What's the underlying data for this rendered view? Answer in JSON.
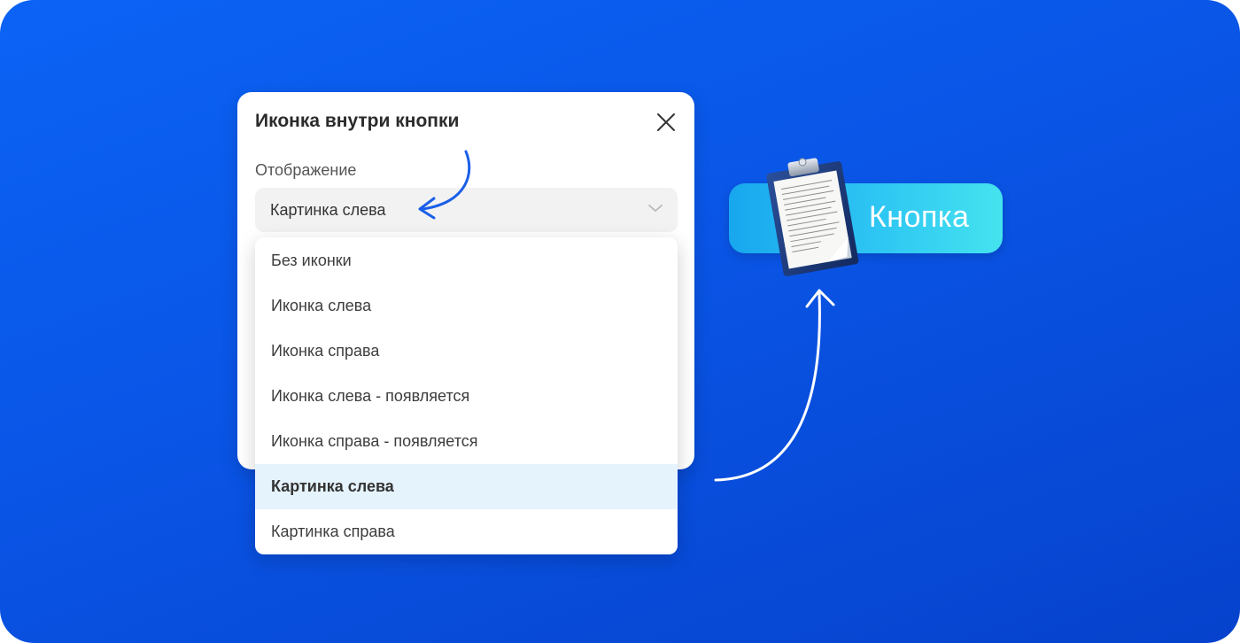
{
  "dialog": {
    "title": "Иконка внутри кнопки",
    "field_label": "Отображение",
    "select_value": "Картинка слева"
  },
  "menu": {
    "items": [
      {
        "label": "Без иконки",
        "selected": false
      },
      {
        "label": "Иконка слева",
        "selected": false
      },
      {
        "label": "Иконка справа",
        "selected": false
      },
      {
        "label": "Иконка слева - появляется",
        "selected": false
      },
      {
        "label": "Иконка справа - появляется",
        "selected": false
      },
      {
        "label": "Картинка слева",
        "selected": true
      },
      {
        "label": "Картинка справа",
        "selected": false
      }
    ]
  },
  "preview": {
    "button_label": "Кнопка",
    "image_icon": "clipboard-icon"
  },
  "colors": {
    "background": "#0a55e6",
    "selected_item": "#e5f3fd",
    "button_gradient_start": "#18a7ee",
    "button_gradient_end": "#45e3ef",
    "annotation_arrow_blue": "#1a5fe8",
    "annotation_arrow_white": "#ffffff"
  }
}
